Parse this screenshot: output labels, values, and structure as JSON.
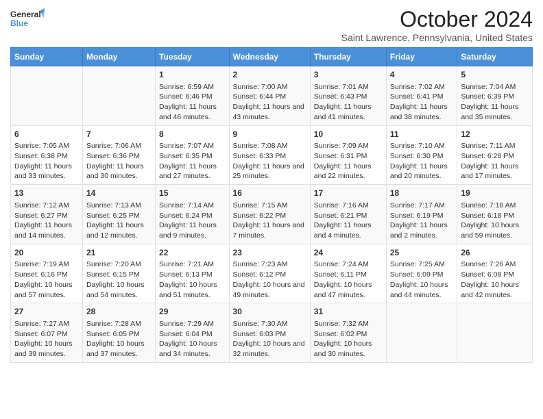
{
  "header": {
    "logo_line1": "General",
    "logo_line2": "Blue",
    "title": "October 2024",
    "subtitle": "Saint Lawrence, Pennsylvania, United States"
  },
  "columns": [
    "Sunday",
    "Monday",
    "Tuesday",
    "Wednesday",
    "Thursday",
    "Friday",
    "Saturday"
  ],
  "weeks": [
    {
      "cells": [
        {
          "day": "",
          "content": ""
        },
        {
          "day": "",
          "content": ""
        },
        {
          "day": "1",
          "content": "Sunrise: 6:59 AM\nSunset: 6:46 PM\nDaylight: 11 hours and 46 minutes."
        },
        {
          "day": "2",
          "content": "Sunrise: 7:00 AM\nSunset: 6:44 PM\nDaylight: 11 hours and 43 minutes."
        },
        {
          "day": "3",
          "content": "Sunrise: 7:01 AM\nSunset: 6:43 PM\nDaylight: 11 hours and 41 minutes."
        },
        {
          "day": "4",
          "content": "Sunrise: 7:02 AM\nSunset: 6:41 PM\nDaylight: 11 hours and 38 minutes."
        },
        {
          "day": "5",
          "content": "Sunrise: 7:04 AM\nSunset: 6:39 PM\nDaylight: 11 hours and 35 minutes."
        }
      ]
    },
    {
      "cells": [
        {
          "day": "6",
          "content": "Sunrise: 7:05 AM\nSunset: 6:38 PM\nDaylight: 11 hours and 33 minutes."
        },
        {
          "day": "7",
          "content": "Sunrise: 7:06 AM\nSunset: 6:36 PM\nDaylight: 11 hours and 30 minutes."
        },
        {
          "day": "8",
          "content": "Sunrise: 7:07 AM\nSunset: 6:35 PM\nDaylight: 11 hours and 27 minutes."
        },
        {
          "day": "9",
          "content": "Sunrise: 7:08 AM\nSunset: 6:33 PM\nDaylight: 11 hours and 25 minutes."
        },
        {
          "day": "10",
          "content": "Sunrise: 7:09 AM\nSunset: 6:31 PM\nDaylight: 11 hours and 22 minutes."
        },
        {
          "day": "11",
          "content": "Sunrise: 7:10 AM\nSunset: 6:30 PM\nDaylight: 11 hours and 20 minutes."
        },
        {
          "day": "12",
          "content": "Sunrise: 7:11 AM\nSunset: 6:28 PM\nDaylight: 11 hours and 17 minutes."
        }
      ]
    },
    {
      "cells": [
        {
          "day": "13",
          "content": "Sunrise: 7:12 AM\nSunset: 6:27 PM\nDaylight: 11 hours and 14 minutes."
        },
        {
          "day": "14",
          "content": "Sunrise: 7:13 AM\nSunset: 6:25 PM\nDaylight: 11 hours and 12 minutes."
        },
        {
          "day": "15",
          "content": "Sunrise: 7:14 AM\nSunset: 6:24 PM\nDaylight: 11 hours and 9 minutes."
        },
        {
          "day": "16",
          "content": "Sunrise: 7:15 AM\nSunset: 6:22 PM\nDaylight: 11 hours and 7 minutes."
        },
        {
          "day": "17",
          "content": "Sunrise: 7:16 AM\nSunset: 6:21 PM\nDaylight: 11 hours and 4 minutes."
        },
        {
          "day": "18",
          "content": "Sunrise: 7:17 AM\nSunset: 6:19 PM\nDaylight: 11 hours and 2 minutes."
        },
        {
          "day": "19",
          "content": "Sunrise: 7:18 AM\nSunset: 6:18 PM\nDaylight: 10 hours and 59 minutes."
        }
      ]
    },
    {
      "cells": [
        {
          "day": "20",
          "content": "Sunrise: 7:19 AM\nSunset: 6:16 PM\nDaylight: 10 hours and 57 minutes."
        },
        {
          "day": "21",
          "content": "Sunrise: 7:20 AM\nSunset: 6:15 PM\nDaylight: 10 hours and 54 minutes."
        },
        {
          "day": "22",
          "content": "Sunrise: 7:21 AM\nSunset: 6:13 PM\nDaylight: 10 hours and 51 minutes."
        },
        {
          "day": "23",
          "content": "Sunrise: 7:23 AM\nSunset: 6:12 PM\nDaylight: 10 hours and 49 minutes."
        },
        {
          "day": "24",
          "content": "Sunrise: 7:24 AM\nSunset: 6:11 PM\nDaylight: 10 hours and 47 minutes."
        },
        {
          "day": "25",
          "content": "Sunrise: 7:25 AM\nSunset: 6:09 PM\nDaylight: 10 hours and 44 minutes."
        },
        {
          "day": "26",
          "content": "Sunrise: 7:26 AM\nSunset: 6:08 PM\nDaylight: 10 hours and 42 minutes."
        }
      ]
    },
    {
      "cells": [
        {
          "day": "27",
          "content": "Sunrise: 7:27 AM\nSunset: 6:07 PM\nDaylight: 10 hours and 39 minutes."
        },
        {
          "day": "28",
          "content": "Sunrise: 7:28 AM\nSunset: 6:05 PM\nDaylight: 10 hours and 37 minutes."
        },
        {
          "day": "29",
          "content": "Sunrise: 7:29 AM\nSunset: 6:04 PM\nDaylight: 10 hours and 34 minutes."
        },
        {
          "day": "30",
          "content": "Sunrise: 7:30 AM\nSunset: 6:03 PM\nDaylight: 10 hours and 32 minutes."
        },
        {
          "day": "31",
          "content": "Sunrise: 7:32 AM\nSunset: 6:02 PM\nDaylight: 10 hours and 30 minutes."
        },
        {
          "day": "",
          "content": ""
        },
        {
          "day": "",
          "content": ""
        }
      ]
    }
  ]
}
